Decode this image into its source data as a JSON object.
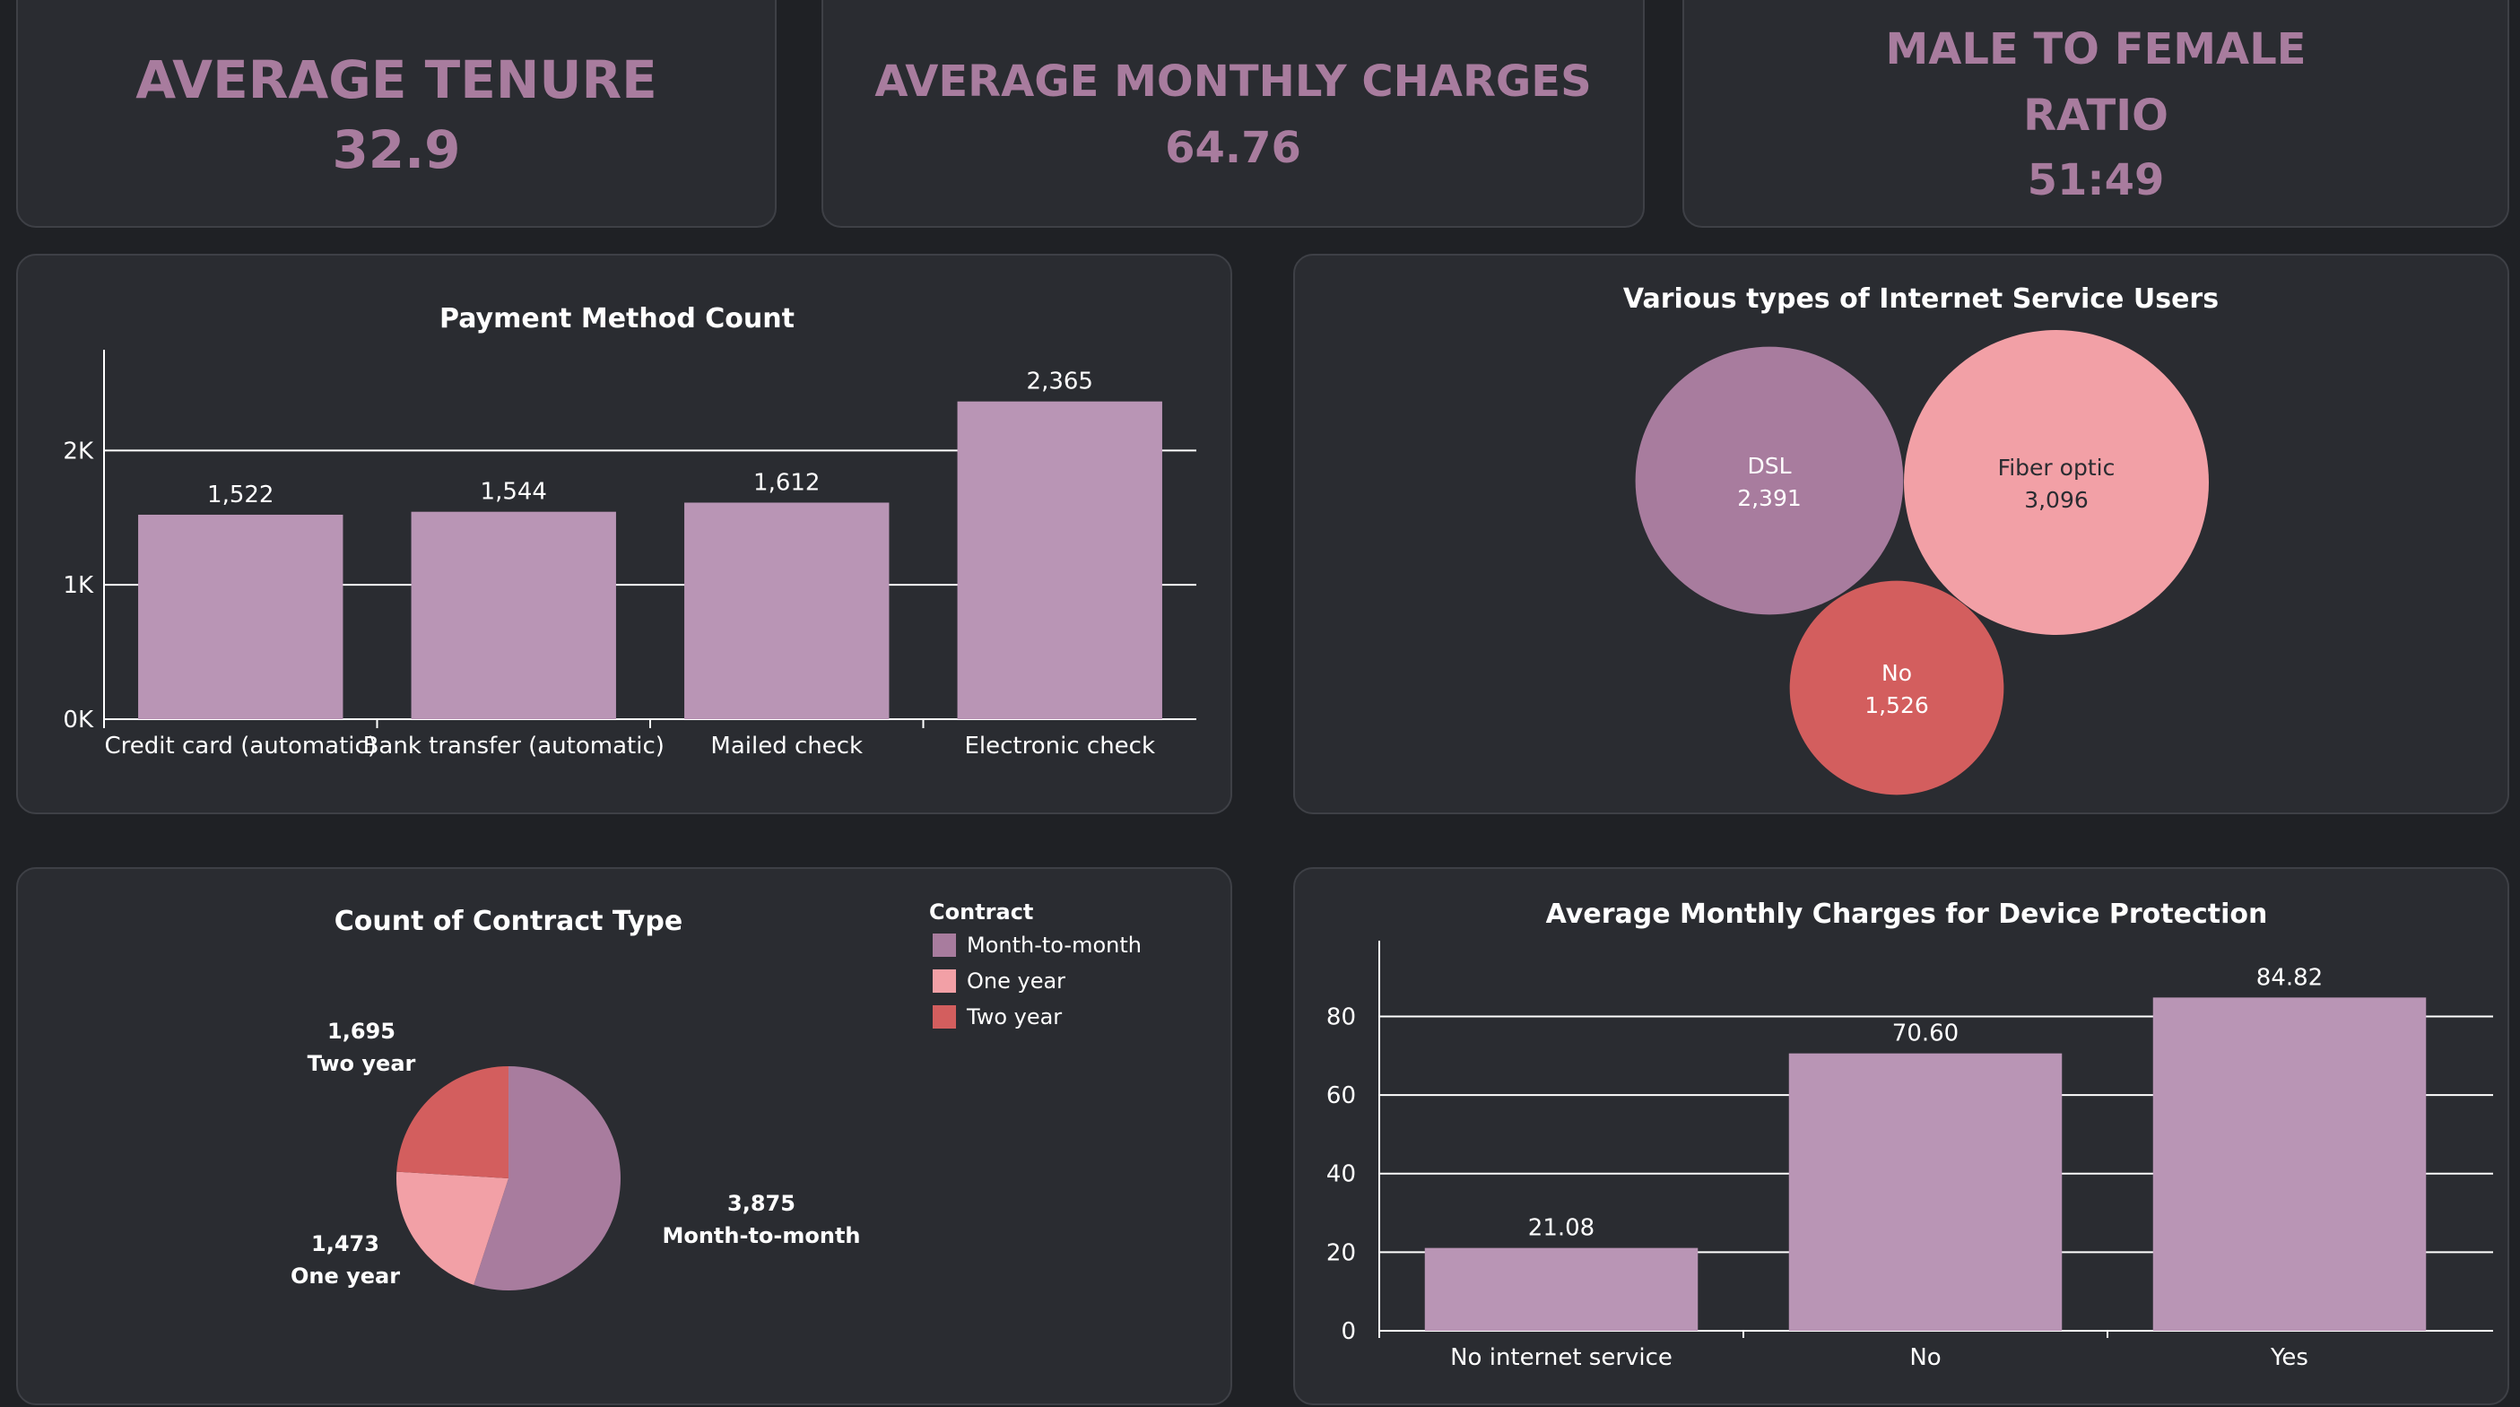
{
  "kpis": {
    "tenure": {
      "label": "AVERAGE TENURE",
      "value": "32.9"
    },
    "monthly": {
      "label": "AVERAGE MONTHLY CHARGES",
      "value": "64.76"
    },
    "ratio": {
      "label_line1": "MALE TO FEMALE",
      "label_line2": "RATIO",
      "value": "51:49"
    }
  },
  "colors": {
    "mauve": "#a87c9e",
    "bar": "#b995b5",
    "pink": "#f2a0a6",
    "red": "#d35e5e",
    "panel": "#2a2c31"
  },
  "chart_data": [
    {
      "id": "payment",
      "type": "bar",
      "title": "Payment Method Count",
      "categories": [
        "Credit card (automatic)",
        "Bank transfer (automatic)",
        "Mailed check",
        "Electronic check"
      ],
      "values": [
        1522,
        1544,
        1612,
        2365
      ],
      "value_labels": [
        "1,522",
        "1,544",
        "1,612",
        "2,365"
      ],
      "yticks": [
        {
          "v": 0,
          "label": "0K"
        },
        {
          "v": 1000,
          "label": "1K"
        },
        {
          "v": 2000,
          "label": "2K"
        }
      ],
      "ylim": [
        0,
        2750
      ],
      "ylabel": "",
      "grid": true
    },
    {
      "id": "internet",
      "type": "bubble",
      "title": "Various types of Internet Service Users",
      "categories": [
        "DSL",
        "Fiber optic",
        "No"
      ],
      "values": [
        2391,
        3096,
        1526
      ],
      "value_labels": [
        "2,391",
        "3,096",
        "1,526"
      ]
    },
    {
      "id": "contract",
      "type": "pie",
      "title": "Count of Contract Type",
      "legend_title": "Contract",
      "legend_position": "top-right",
      "categories": [
        "Month-to-month",
        "One year",
        "Two year"
      ],
      "values": [
        3875,
        1473,
        1695
      ],
      "value_labels": [
        "3,875",
        "1,473",
        "1,695"
      ]
    },
    {
      "id": "device",
      "type": "bar",
      "title": "Average Monthly Charges for Device Protection",
      "categories": [
        "No internet service",
        "No",
        "Yes"
      ],
      "values": [
        21.08,
        70.6,
        84.82
      ],
      "value_labels": [
        "21.08",
        "70.60",
        "84.82"
      ],
      "yticks": [
        {
          "v": 0,
          "label": "0"
        },
        {
          "v": 20,
          "label": "20"
        },
        {
          "v": 40,
          "label": "40"
        },
        {
          "v": 60,
          "label": "60"
        },
        {
          "v": 80,
          "label": "80"
        }
      ],
      "ylim": [
        0,
        97
      ],
      "grid": true
    }
  ]
}
